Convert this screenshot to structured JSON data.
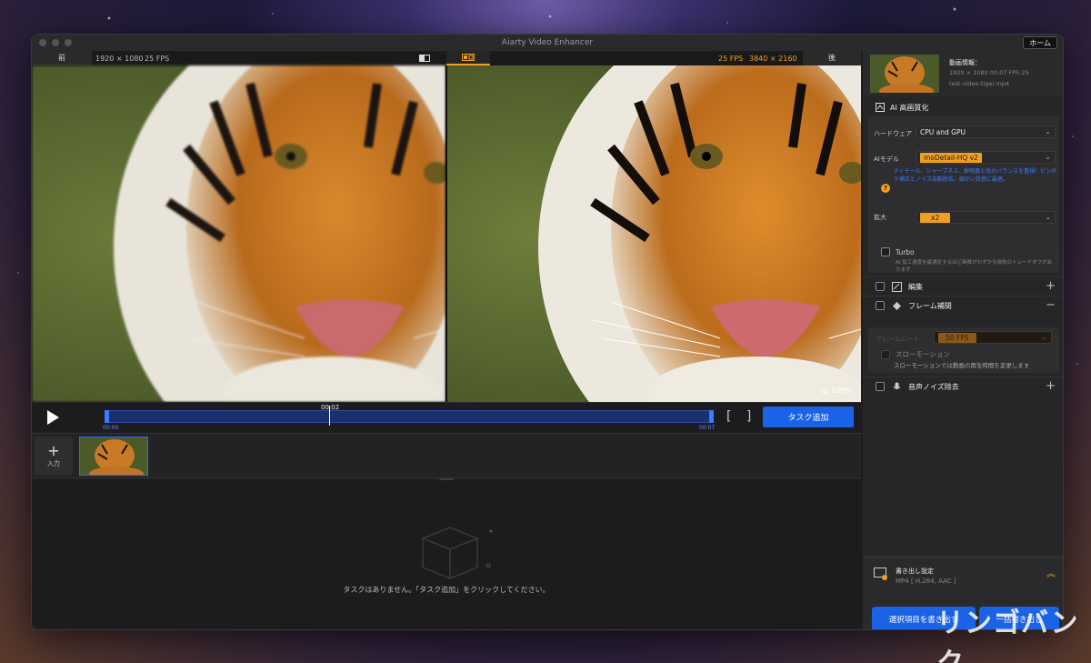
{
  "window": {
    "title": "Aiarty Video Enhancer",
    "home_label": "ホーム"
  },
  "compare": {
    "before_label": "前",
    "before_resolution": "1920 × 1080",
    "before_fps": "25 FPS",
    "after_fps": "25 FPS",
    "after_resolution": "3840 × 2160",
    "after_label": "後",
    "zoom": "100%"
  },
  "timeline": {
    "current_time": "00:02",
    "start_time": "00:00",
    "end_time": "00:07",
    "add_task_label": "タスク追加"
  },
  "clips": {
    "input_label": "入力"
  },
  "tasks": {
    "empty_message": "タスクはありません。「タスク追加」をクリックしてください。"
  },
  "video_info": {
    "title": "動画情報：",
    "meta": "1920 × 1080  00:07  FPS:25",
    "filename": "test-video-tiger.mp4"
  },
  "ai_section": {
    "title": "AI 高画質化",
    "hardware_label": "ハードウェア",
    "hardware_value": "CPU and GPU",
    "model_label": "AIモデル",
    "model_value": "moDetail-HQ  v2",
    "model_desc": "ディテール、シャープネス、鮮明度と色のバランスを重視！ピンボケ補正とノイズ自動除去。細かい質感に最適。",
    "scale_label": "拡大",
    "scale_value": "x2",
    "turbo_label": "Turbo",
    "turbo_desc": "AI 加工速度を最適化するほど画質がわずかな損失のトレードオフがあります"
  },
  "options": {
    "edit_label": "編集",
    "frame_interp_label": "フレーム補間",
    "frame_rate_label": "フレームレート",
    "frame_rate_value": "50 FPS",
    "slowmo_label": "スローモーション",
    "slowmo_desc": "スローモーションでは動画の再生時間を変更します",
    "denoise_label": "音声ノイズ除去"
  },
  "export": {
    "title": "書き出し設定",
    "format": "MP4 [ H.264, AAC ]",
    "export_selected": "選択項目を書き出す",
    "export_all": "一括書き出し"
  },
  "watermark": "リンゴバンク",
  "colors": {
    "accent": "#1a62e6",
    "highlight": "#f0a020",
    "window_bg": "#1e1e20"
  }
}
